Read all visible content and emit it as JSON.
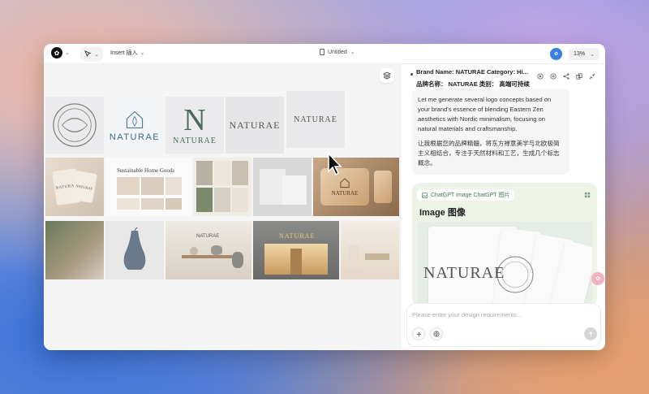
{
  "toolbar": {
    "insert_label": "Insert 插入",
    "doc_title": "Untitled",
    "zoom": "13%",
    "chevron": "⌄"
  },
  "canvas": {
    "brand_word": "NATURAE",
    "logo_letter": "N",
    "home_goods_title": "Sustainable Home Goods"
  },
  "chat": {
    "header_line1": "Brand Name: NATURAE Category: Hi...",
    "header_line2": "品牌名称：  NATURAE 类别：  高端可持续",
    "reply_en": "Let me generate several logo concepts based on your brand's essence of blending Eastern Zen aesthetics with Nordic minimalism, focusing on natural materials and craftsmanship.",
    "reply_zh": "让我根据您的品牌精髓，将东方禅意美学与北欧极简主义相结合，专注于天然材料和工艺，生成几个标志概念。",
    "image_tag": "ChatGPT Image  ChatGPT 图片",
    "image_title": "Image  图像",
    "preview_word": "NATURAE"
  },
  "input": {
    "placeholder": "Please enter your design requirements..."
  },
  "colors": {
    "accent": "#3b7fe0",
    "tag_green": "#3e7a4a",
    "logo_green": "#4a6a5a",
    "wood": "#c9a070"
  },
  "icons": [
    "logo-icon",
    "cursor-tool-icon",
    "document-icon",
    "layers-icon",
    "play-icon",
    "settings-icon",
    "share-icon",
    "copy-icon",
    "collapse-icon",
    "grid-icon",
    "plus-icon",
    "globe-icon",
    "send-icon"
  ]
}
